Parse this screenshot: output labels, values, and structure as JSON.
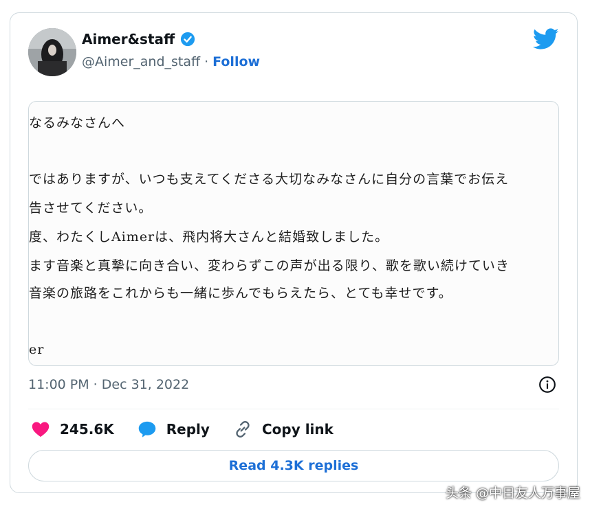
{
  "tweet": {
    "display_name": "Aimer&staff",
    "handle": "@Aimer_and_staff",
    "separator": "·",
    "follow_label": "Follow",
    "timestamp": "11:00 PM · Dec 31, 2022",
    "image_text": [
      "なるみなさんへ",
      "ではありますが、いつも支えてくださる大切なみなさんに自分の言葉でお伝え",
      "告させてください。",
      "度、わたくしAimerは、飛内将大さんと結婚致しました。",
      "ます音楽と真摯に向き合い、変わらずこの声が出る限り、歌を歌い続けていき",
      "音楽の旅路をこれからも一緒に歩んでもらえたら、とても幸せです。",
      "er"
    ],
    "actions": {
      "like_count": "245.6K",
      "reply_label": "Reply",
      "copy_link_label": "Copy link"
    },
    "read_replies_label": "Read 4.3K replies",
    "icons": {
      "verified": "verified-badge-icon",
      "brand": "twitter-bird-icon",
      "info": "info-icon",
      "like": "heart-icon",
      "reply": "speech-bubble-icon",
      "copy": "link-icon"
    }
  },
  "watermark": "头条 @中日友人万事屋",
  "colors": {
    "brand_blue": "#1d9bf0",
    "link_blue": "#1d6fd6",
    "like_pink": "#f91880",
    "text_primary": "#0f1419",
    "text_secondary": "#536471",
    "border": "#cfd9de"
  }
}
